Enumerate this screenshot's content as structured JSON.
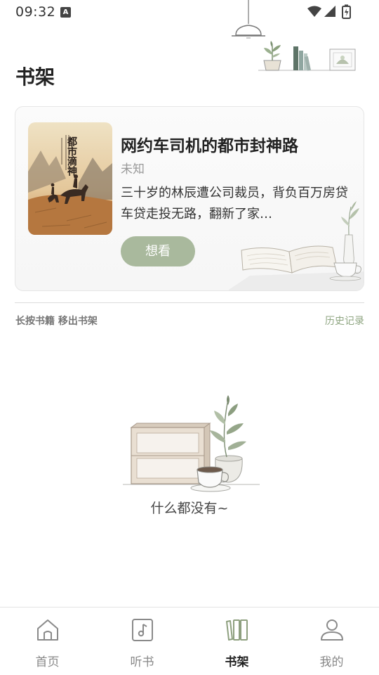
{
  "status_bar": {
    "time": "09:32",
    "badge": "A"
  },
  "header": {
    "title": "书架"
  },
  "recommend": {
    "title": "网约车司机的都市封神路",
    "author": "未知",
    "description": "三十岁的林辰遭公司裁员，背负百万房贷车贷走投无路，翻新了家…",
    "action_label": "想看",
    "cover_title": "都市滴神"
  },
  "shelf_bar": {
    "hint": "长按书籍 移出书架",
    "history_label": "历史记录"
  },
  "empty_state": {
    "message": "什么都没有~"
  },
  "bottom_nav": {
    "items": [
      {
        "label": "首页",
        "icon": "home-icon",
        "active": false
      },
      {
        "label": "听书",
        "icon": "music-note-icon",
        "active": false
      },
      {
        "label": "书架",
        "icon": "bookshelf-icon",
        "active": true
      },
      {
        "label": "我的",
        "icon": "profile-icon",
        "active": false
      }
    ]
  },
  "colors": {
    "accent": "#a9b99d",
    "history_link": "#8fa682",
    "active_nav": "#8ea07f"
  }
}
